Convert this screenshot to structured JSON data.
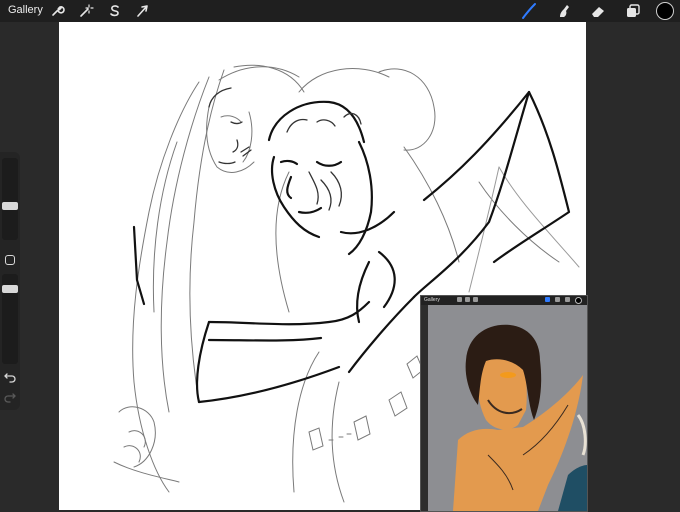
{
  "toolbar": {
    "gallery_label": "Gallery",
    "left_tools": [
      "wrench-icon",
      "magic-wand-icon",
      "selection-s-icon",
      "transform-arrow-icon"
    ],
    "right_tools": [
      "brush-icon",
      "smudge-icon",
      "eraser-icon",
      "layers-icon"
    ],
    "active_tool": "brush-icon",
    "accent_color": "#2f7bff",
    "current_color": "#000000"
  },
  "sidebar": {
    "brush_size_level": 0.4,
    "opacity_level": 0.5,
    "buttons": [
      "modify-square-icon",
      "undo-icon",
      "redo-icon"
    ]
  },
  "reference": {
    "gallery_label": "Gallery",
    "skin_color": "#e39a4e",
    "background_color": "#8d8e92",
    "hair_color": "#2b1c14",
    "eye_color": "#f39a1c",
    "accent_teal": "#1f4e64"
  }
}
